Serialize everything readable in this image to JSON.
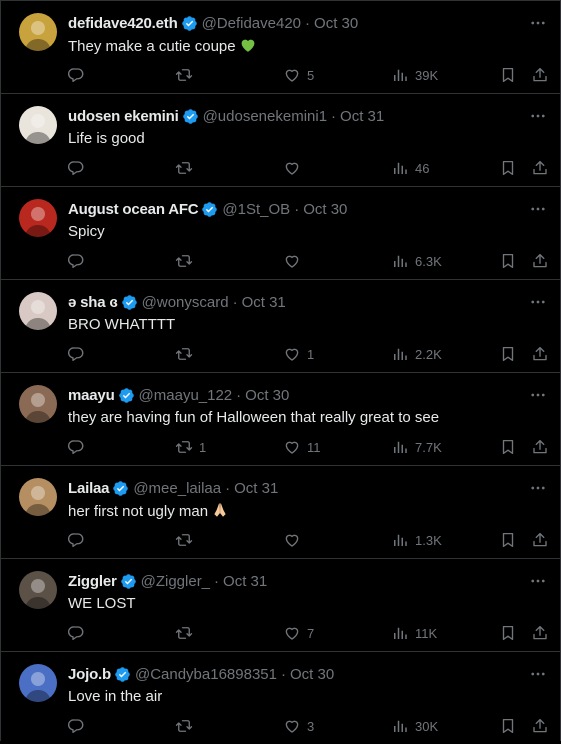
{
  "colors": {
    "background": "#000000",
    "text": "#e7e9ea",
    "muted": "#71767b",
    "verified": "#1d9bf0",
    "divider": "#2f3336"
  },
  "tweets": [
    {
      "name": "defidave420.eth",
      "handle": "@Defidave420",
      "dot": "·",
      "date": "Oct 30",
      "text": "They make a cutie coupe",
      "emoji": "green-heart",
      "replies": "",
      "retweets": "",
      "likes": "5",
      "views": "39K",
      "avatar_color": "#c8a23c"
    },
    {
      "name": "udosen ekemini",
      "handle": "@udosenekemini1",
      "dot": "·",
      "date": "Oct 31",
      "text": "Life is good",
      "emoji": "",
      "replies": "",
      "retweets": "",
      "likes": "",
      "views": "46",
      "avatar_color": "#e9e4dc"
    },
    {
      "name": "August ocean AFC",
      "handle": "@1St_OB",
      "dot": "·",
      "date": "Oct 30",
      "text": "Spicy",
      "emoji": "",
      "replies": "",
      "retweets": "",
      "likes": "",
      "views": "6.3K",
      "avatar_color": "#b8281e"
    },
    {
      "name": "ə sha ɞ",
      "handle": "@wonyscard",
      "dot": "·",
      "date": "Oct 31",
      "text": "BRO WHATTTT",
      "emoji": "",
      "replies": "",
      "retweets": "",
      "likes": "1",
      "views": "2.2K",
      "avatar_color": "#d9c9c4"
    },
    {
      "name": "maayu",
      "handle": "@maayu_122",
      "dot": "·",
      "date": "Oct 30",
      "text": "they are having fun of Halloween that really great to see",
      "emoji": "",
      "replies": "",
      "retweets": "1",
      "likes": "11",
      "views": "7.7K",
      "avatar_color": "#8a6a55"
    },
    {
      "name": "Lailaa",
      "handle": "@mee_lailaa",
      "dot": "·",
      "date": "Oct 31",
      "text": "her first not ugly man",
      "emoji": "folded-hands",
      "replies": "",
      "retweets": "",
      "likes": "",
      "views": "1.3K",
      "avatar_color": "#b58f62"
    },
    {
      "name": "Ziggler",
      "handle": "@Ziggler_",
      "dot": "·",
      "date": "Oct 31",
      "text": "WE LOST",
      "emoji": "",
      "replies": "",
      "retweets": "",
      "likes": "7",
      "views": "11K",
      "avatar_color": "#5b5147"
    },
    {
      "name": "Jojo.b",
      "handle": "@Candyba16898351",
      "dot": "·",
      "date": "Oct 30",
      "text": "Love in the air",
      "emoji": "",
      "replies": "",
      "retweets": "",
      "likes": "3",
      "views": "30K",
      "avatar_color": "#4a6fc4"
    }
  ]
}
